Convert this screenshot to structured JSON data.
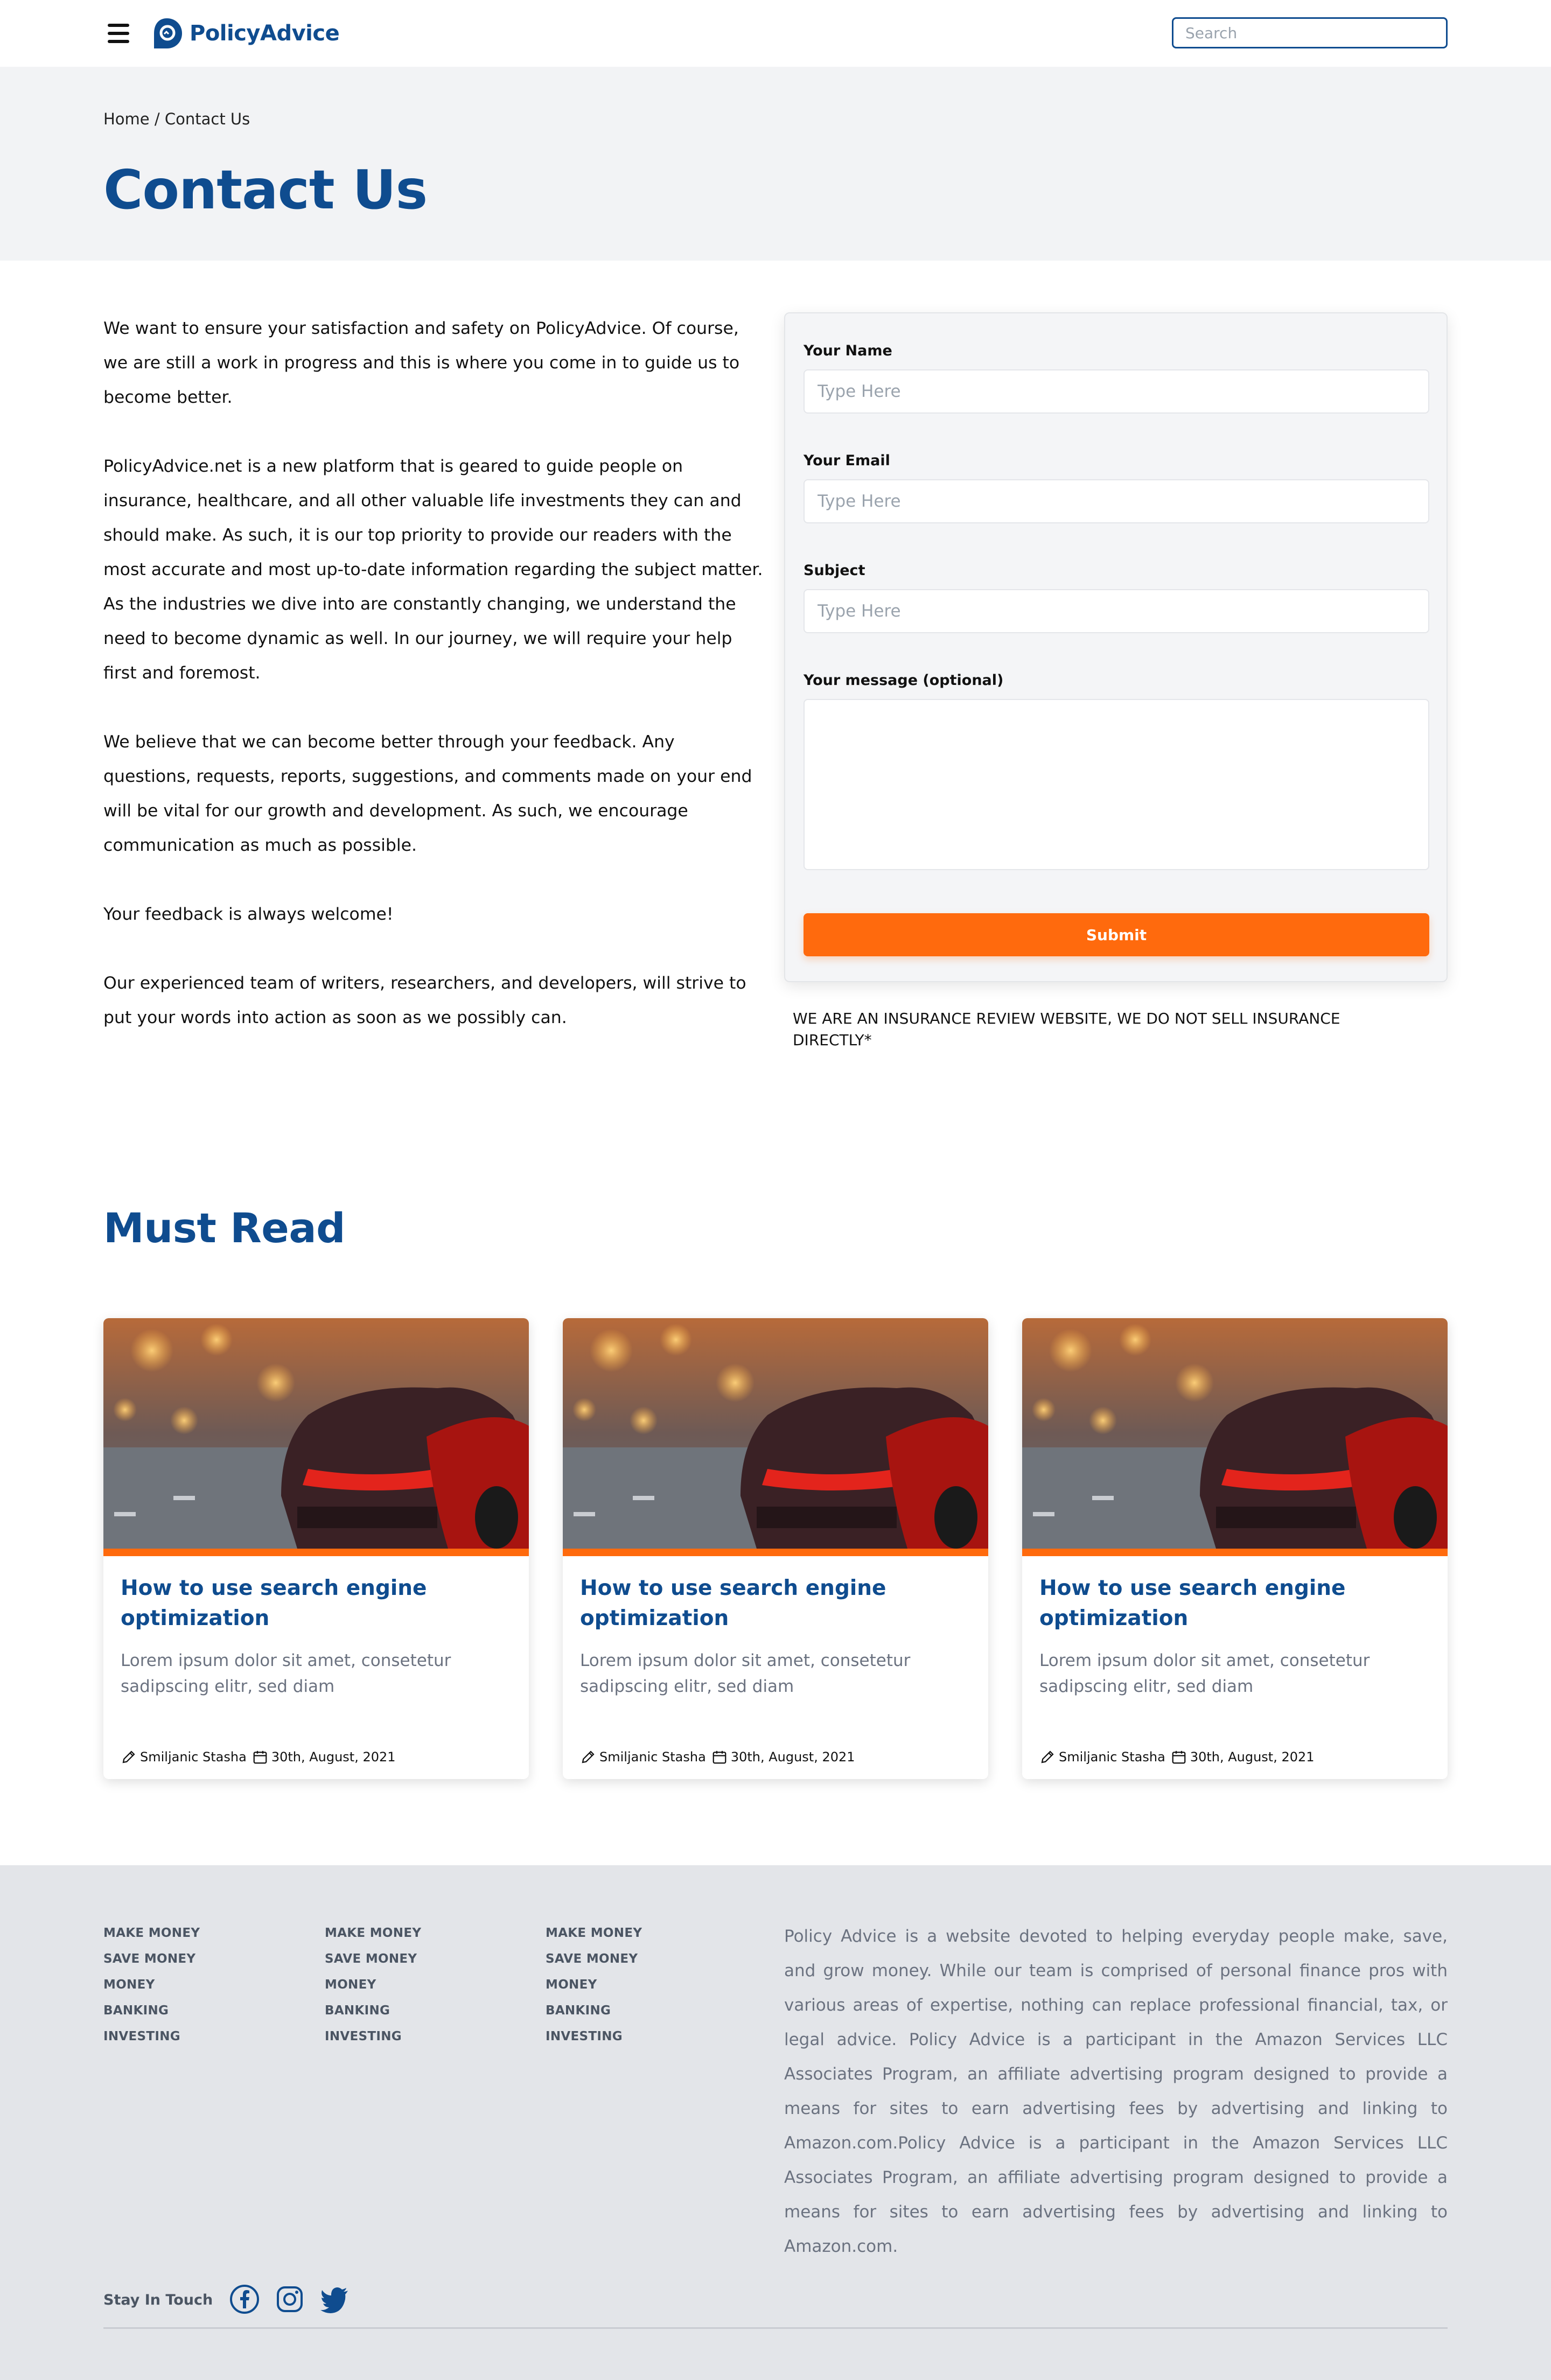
{
  "header": {
    "brand": "PolicyAdvice",
    "search_placeholder": "Search"
  },
  "breadcrumb": {
    "home": "Home",
    "separator": " / ",
    "current": "Contact Us"
  },
  "page_title": "Contact Us",
  "intro_paragraphs": [
    "We want to ensure your satisfaction and safety on PolicyAdvice. Of course, we are still a work in progress and this is where you come in to guide us to become better.",
    "PolicyAdvice.net is a new platform that is geared to guide people on insurance, healthcare, and all other valuable life investments they can and should make. As such, it is our top priority to provide our readers with the most accurate and most up-to-date information regarding the subject matter. As the industries we dive into are constantly changing, we understand the need to become dynamic as well. In our journey, we will require your help first and foremost.",
    "We believe that we can become better through your feedback. Any questions, requests, reports, suggestions, and comments made on your end will be vital for our growth and development. As such, we encourage communication as much as possible.",
    "Your feedback is always welcome!",
    "Our experienced team of writers, researchers, and developers, will strive to put your words into action as soon as we possibly can."
  ],
  "form": {
    "name_label": "Your Name",
    "name_placeholder": "Type Here",
    "email_label": "Your Email",
    "email_placeholder": "Type Here",
    "subject_label": "Subject",
    "subject_placeholder": "Type Here",
    "message_label": "Your message (optional)",
    "submit_label": "Submit"
  },
  "disclaimer": "WE ARE AN INSURANCE REVIEW WEBSITE, WE DO NOT SELL INSURANCE DIRECTLY*",
  "must_read": {
    "title": "Must Read",
    "cards": [
      {
        "title": "How to use search engine optimization",
        "excerpt": "Lorem ipsum dolor sit amet, consetetur sadipscing elitr, sed diam",
        "author": "Smiljanic Stasha",
        "date": "30th, August, 2021"
      },
      {
        "title": "How to use search engine optimization",
        "excerpt": "Lorem ipsum dolor sit amet, consetetur sadipscing elitr, sed diam",
        "author": "Smiljanic Stasha",
        "date": "30th, August, 2021"
      },
      {
        "title": "How to use search engine optimization",
        "excerpt": "Lorem ipsum dolor sit amet, consetetur sadipscing elitr, sed diam",
        "author": "Smiljanic Stasha",
        "date": "30th, August, 2021"
      }
    ]
  },
  "footer": {
    "columns": [
      [
        "MAKE MONEY",
        "SAVE MONEY",
        "MONEY",
        "BANKING",
        "INVESTING"
      ],
      [
        "MAKE MONEY",
        "SAVE MONEY",
        "MONEY",
        "BANKING",
        "INVESTING"
      ],
      [
        "MAKE MONEY",
        "SAVE MONEY",
        "MONEY",
        "BANKING",
        "INVESTING"
      ]
    ],
    "about": "Policy Advice is a website devoted to helping everyday people make, save, and grow money. While our team is comprised of personal finance pros with various areas of expertise, nothing can replace professional financial, tax, or legal advice. Policy Advice is a participant in the Amazon Services LLC Associates Program, an affiliate advertising program designed to provide a means for sites to earn advertising fees by advertising and linking to Amazon.com.Policy Advice is a participant in the Amazon Services LLC Associates Program, an affiliate advertising program designed to provide a means for sites to earn advertising fees by advertising and linking to Amazon.com.",
    "stay_in_touch": "Stay In Touch",
    "social_icons": [
      "facebook-icon",
      "instagram-icon",
      "twitter-icon"
    ]
  },
  "colors": {
    "brand_blue": "#0f4c8f",
    "accent_orange": "#ff6a0d",
    "hero_bg": "#f2f3f5",
    "footer_bg": "#e3e5e9"
  }
}
